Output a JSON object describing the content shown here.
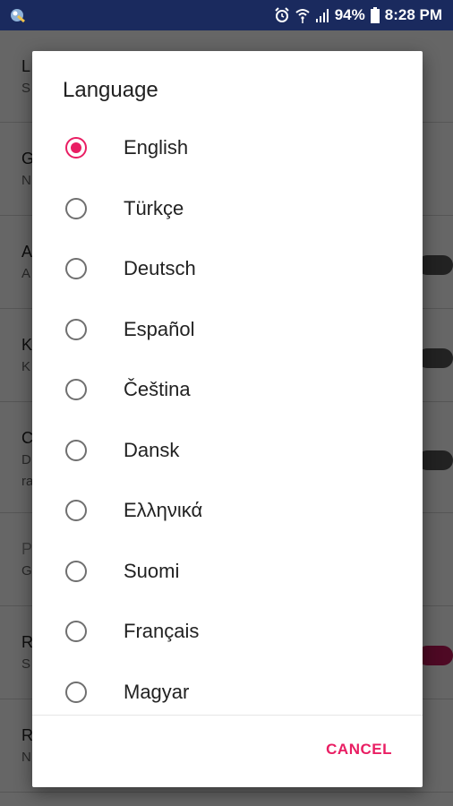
{
  "status_bar": {
    "battery": "94%",
    "time": "8:28 PM",
    "icons": [
      "app-icon",
      "alarm-icon",
      "wifi-icon",
      "signal-icon",
      "battery-icon"
    ]
  },
  "background_list": {
    "items": [
      {
        "title": "L",
        "sub": "S"
      },
      {
        "title": "G",
        "sub": "N"
      },
      {
        "title": "A",
        "sub": "A"
      },
      {
        "title": "K",
        "sub": "K"
      },
      {
        "title": "C",
        "sub": "D",
        "sub2": "ra"
      },
      {
        "title": "P",
        "sub": "G"
      },
      {
        "title": "R",
        "sub": "S"
      },
      {
        "title": "R",
        "sub": "N"
      }
    ]
  },
  "dialog": {
    "title": "Language",
    "selected_index": 0,
    "options": [
      "English",
      "Türkçe",
      "Deutsch",
      "Español",
      "Čeština",
      "Dansk",
      "Ελληνικά",
      "Suomi",
      "Français",
      "Magyar"
    ],
    "cancel_label": "CANCEL",
    "accent_color": "#e91e63"
  }
}
